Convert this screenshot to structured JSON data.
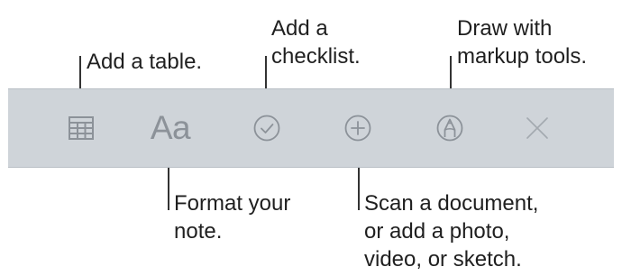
{
  "toolbar": {
    "icons": [
      "table-icon",
      "format-icon",
      "checklist-icon",
      "add-icon",
      "markup-icon",
      "close-icon"
    ],
    "format_glyph": "Aa",
    "icon_color": "#8c9299",
    "background_color": "#cfd4d9"
  },
  "callouts": {
    "table": "Add a table.",
    "checklist": "Add a\nchecklist.",
    "markup": "Draw with\nmarkup tools.",
    "format": "Format your\nnote.",
    "scan": "Scan a document,\nor add a photo,\nvideo, or sketch."
  }
}
